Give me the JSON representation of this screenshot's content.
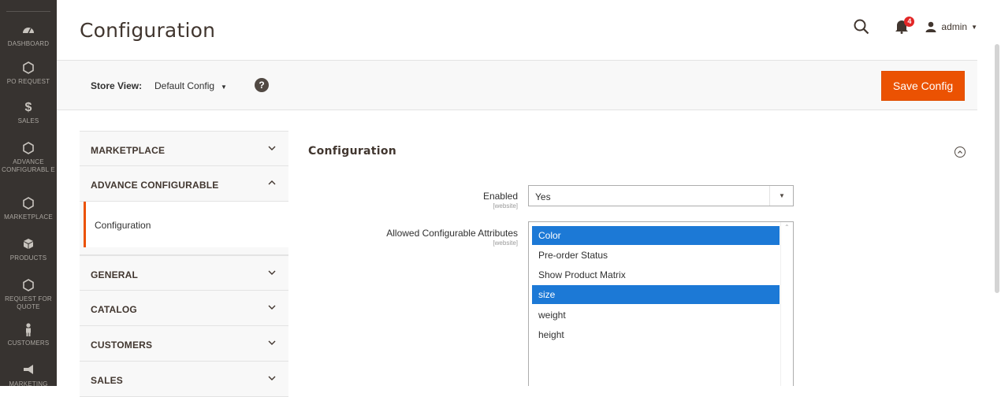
{
  "nav": {
    "items": [
      {
        "label": "DASHBOARD",
        "icon": "dashboard-gauge-icon"
      },
      {
        "label": "PO REQUEST",
        "icon": "hexagon-icon"
      },
      {
        "label": "SALES",
        "icon": "dollar-icon"
      },
      {
        "label": "ADVANCE CONFIGURABL E",
        "icon": "hexagon-icon"
      },
      {
        "label": "MARKETPLACE",
        "icon": "hexagon-icon"
      },
      {
        "label": "PRODUCTS",
        "icon": "box-icon"
      },
      {
        "label": "REQUEST FOR QUOTE",
        "icon": "hexagon-icon"
      },
      {
        "label": "CUSTOMERS",
        "icon": "person-icon"
      },
      {
        "label": "MARKETING",
        "icon": "megaphone-icon"
      }
    ]
  },
  "header": {
    "title": "Configuration",
    "notifications_count": "4",
    "user_name": "admin"
  },
  "store_bar": {
    "label": "Store View:",
    "value": "Default Config",
    "save_label": "Save Config"
  },
  "tabs": [
    {
      "title": "MARKETPLACE",
      "expanded": false
    },
    {
      "title": "ADVANCE CONFIGURABLE",
      "expanded": true,
      "items": [
        "Configuration"
      ]
    },
    {
      "title": "GENERAL",
      "expanded": false
    },
    {
      "title": "CATALOG",
      "expanded": false
    },
    {
      "title": "CUSTOMERS",
      "expanded": false
    },
    {
      "title": "SALES",
      "expanded": false
    }
  ],
  "section": {
    "title": "Configuration",
    "fields": {
      "enabled": {
        "label": "Enabled",
        "scope": "[website]",
        "value": "Yes"
      },
      "attributes": {
        "label": "Allowed Configurable Attributes",
        "scope": "[website]",
        "options": [
          {
            "label": "Color",
            "selected": true
          },
          {
            "label": "Pre-order Status",
            "selected": false
          },
          {
            "label": "Show Product Matrix",
            "selected": false
          },
          {
            "label": "size",
            "selected": true
          },
          {
            "label": "weight",
            "selected": false
          },
          {
            "label": "height",
            "selected": false
          }
        ]
      }
    }
  },
  "colors": {
    "nav_bg": "#373330",
    "accent": "#eb5202",
    "selected_option": "#1c79d6",
    "badge": "#e22626"
  }
}
